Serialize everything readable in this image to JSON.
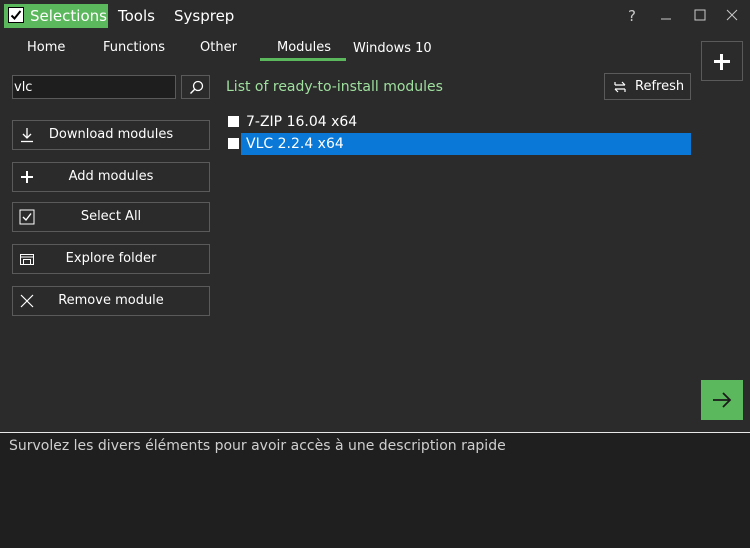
{
  "menu": {
    "selections_label": "Selections",
    "tools_label": "Tools",
    "sysprep_label": "Sysprep"
  },
  "window": {
    "help_label": "?",
    "minimize_label": "—",
    "maximize_label": "☐",
    "close_label": "✕"
  },
  "tabs": [
    {
      "label": "Home"
    },
    {
      "label": "Functions"
    },
    {
      "label": "Other"
    },
    {
      "label": "Modules",
      "active": true
    },
    {
      "label": "Windows 10"
    }
  ],
  "search": {
    "value": "vlc",
    "icon": "search-icon"
  },
  "side_buttons": [
    {
      "label": "Download modules",
      "icon": "download-icon"
    },
    {
      "label": "Add modules",
      "icon": "plus-icon"
    },
    {
      "label": "Select All",
      "icon": "checkbox-icon"
    },
    {
      "label": "Explore folder",
      "icon": "folder-icon"
    },
    {
      "label": "Remove module",
      "icon": "close-icon"
    }
  ],
  "modules": {
    "title": "List of ready-to-install modules",
    "refresh_label": "Refresh",
    "items": [
      {
        "label": "7-ZIP 16.04 x64",
        "selected": false
      },
      {
        "label": "VLC 2.2.4 x64",
        "selected": true
      }
    ]
  },
  "description": "Survolez les divers éléments pour avoir accès à une description rapide",
  "colors": {
    "accent": "#5cb85c",
    "selection": "#0a78d7",
    "background": "#2b2b2b",
    "list_title": "#9fe09f"
  }
}
